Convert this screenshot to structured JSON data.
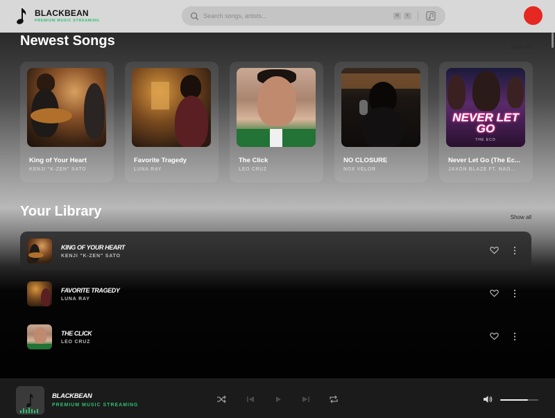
{
  "header": {
    "brand": "BLACKBEAN",
    "brand_tagline": "PREMIUM MUSIC STREAMING",
    "search_placeholder": "Search songs, artists...",
    "avatar_color": "#e52822"
  },
  "newest": {
    "title": "Newest Songs",
    "show_all": "Show all",
    "songs": [
      {
        "title": "King of Your Heart",
        "artist": "KENJI \"K-ZEN\" SATO"
      },
      {
        "title": "Favorite Tragedy",
        "artist": "LUNA RAY"
      },
      {
        "title": "The Click",
        "artist": "LEO CRUZ"
      },
      {
        "title": "NO CLOSURE",
        "artist": "NOX VELOR"
      },
      {
        "title": "Never Let Go (The Ec...",
        "artist": "JAXON BLAZE FT. NAO...",
        "cover_text": "NEVER LET GO",
        "cover_subtext": "THE ECO"
      }
    ]
  },
  "library": {
    "title": "Your Library",
    "show_all": "Show all",
    "items": [
      {
        "title": "KING OF YOUR HEART",
        "artist": "KENJI \"K-ZEN\" SATO"
      },
      {
        "title": "FAVORITE TRAGEDY",
        "artist": "LUNA RAY"
      },
      {
        "title": "THE CLICK",
        "artist": "LEO CRUZ"
      }
    ]
  },
  "player": {
    "title": "BLACKBEAN",
    "subtitle": "PREMIUM MUSIC STREAMING",
    "volume": 0.72,
    "accent": "#2fbf71"
  }
}
